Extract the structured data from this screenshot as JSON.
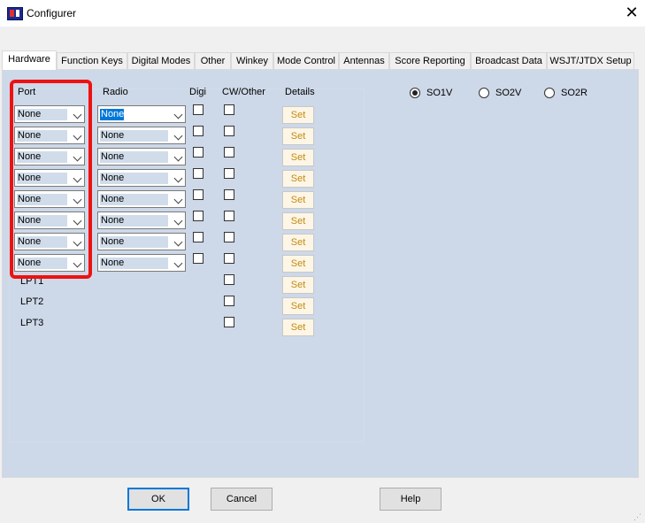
{
  "window": {
    "title": "Configurer",
    "close_glyph": "✕"
  },
  "tabs": [
    {
      "label": "Hardware",
      "active": true
    },
    {
      "label": "Function Keys"
    },
    {
      "label": "Digital Modes"
    },
    {
      "label": "Other"
    },
    {
      "label": "Winkey"
    },
    {
      "label": "Mode Control"
    },
    {
      "label": "Antennas"
    },
    {
      "label": "Score Reporting"
    },
    {
      "label": "Broadcast Data"
    },
    {
      "label": "WSJT/JTDX Setup"
    }
  ],
  "hardware": {
    "headers": {
      "port": "Port",
      "radio": "Radio",
      "digi": "Digi",
      "cw_other": "CW/Other",
      "details": "Details"
    },
    "rows": [
      {
        "port": "None",
        "radio": "None",
        "radio_selected": true
      },
      {
        "port": "None",
        "radio": "None"
      },
      {
        "port": "None",
        "radio": "None"
      },
      {
        "port": "None",
        "radio": "None"
      },
      {
        "port": "None",
        "radio": "None"
      },
      {
        "port": "None",
        "radio": "None"
      },
      {
        "port": "None",
        "radio": "None"
      },
      {
        "port": "None",
        "radio": "None"
      }
    ],
    "lpt_labels": [
      "LPT1",
      "LPT2",
      "LPT3"
    ],
    "set_label": "Set",
    "so_modes": [
      {
        "label": "SO1V",
        "selected": true
      },
      {
        "label": "SO2V",
        "selected": false
      },
      {
        "label": "SO2R",
        "selected": false
      }
    ]
  },
  "buttons": {
    "ok": "OK",
    "cancel": "Cancel",
    "help": "Help"
  },
  "colors": {
    "panel_bg": "#cdd8e8",
    "highlight_border": "#ee1111",
    "set_text": "#c48a10",
    "selection": "#0078d7"
  },
  "icons": {
    "app": "n1mm-logo-icon",
    "close": "close-icon",
    "dropdown": "chevron-down-icon",
    "resize": "resize-grip-icon"
  }
}
